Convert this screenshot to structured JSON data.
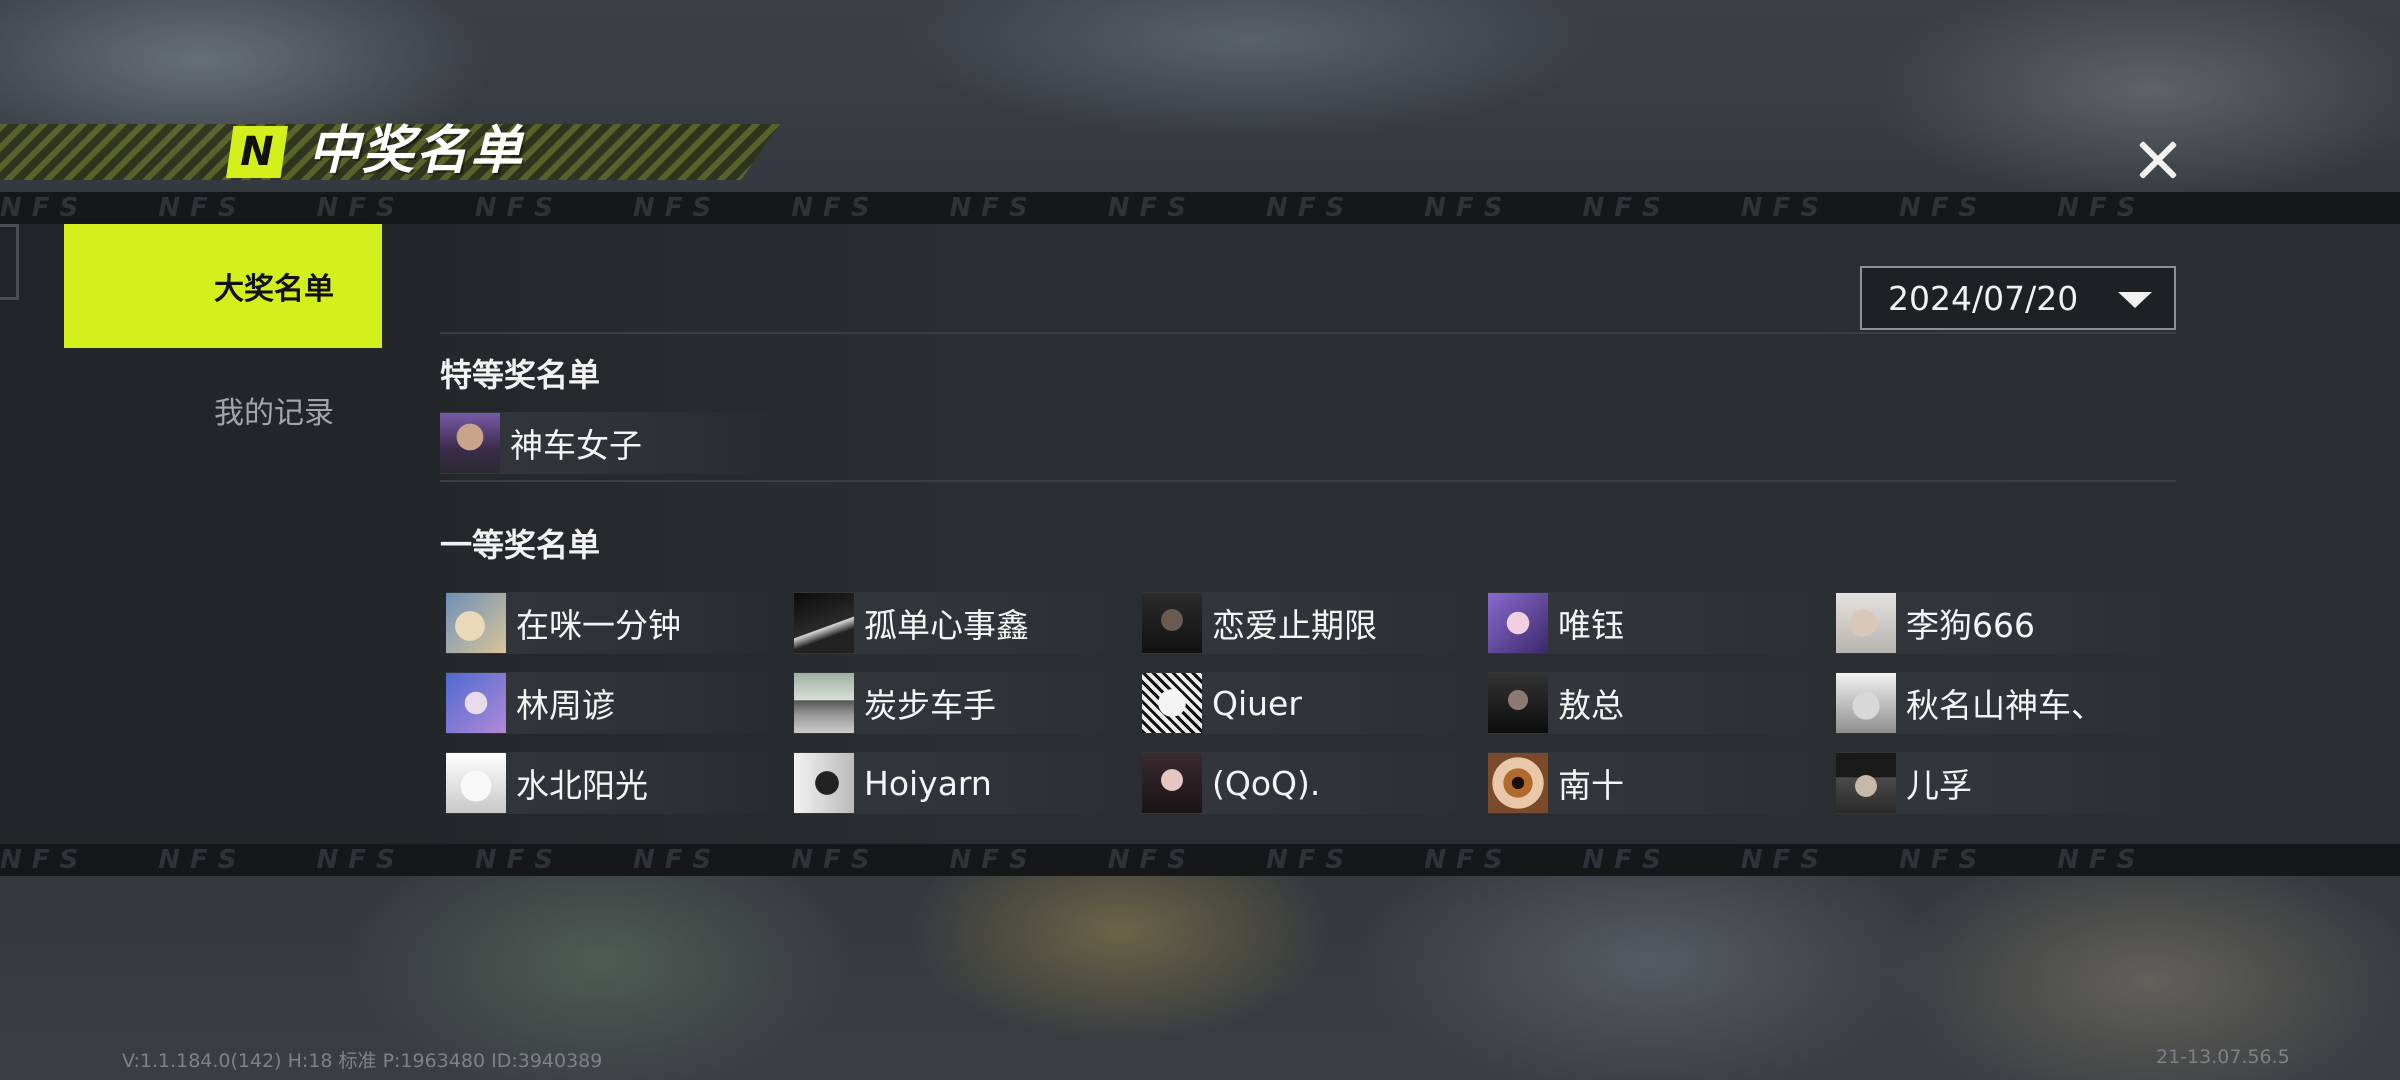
{
  "header": {
    "logo_letter": "N",
    "title": "中奖名单"
  },
  "nfs_watermark": [
    "NFS",
    "NFS",
    "NFS",
    "NFS",
    "NFS",
    "NFS",
    "NFS",
    "NFS",
    "NFS",
    "NFS",
    "NFS",
    "NFS",
    "NFS",
    "NFS"
  ],
  "sidebar": {
    "tabs": [
      {
        "label": "大奖名单",
        "active": true
      },
      {
        "label": "我的记录",
        "active": false
      }
    ]
  },
  "date_select": {
    "value": "2024/07/20"
  },
  "sections": {
    "grand": {
      "title": "特等奖名单",
      "winners": [
        {
          "name": "神车女子",
          "avatar": "avatar-purple-hair"
        }
      ]
    },
    "first": {
      "title": "一等奖名单",
      "winners": [
        {
          "name": "在咪一分钟",
          "avatar": "avatar-cartoon"
        },
        {
          "name": "孤单心事鑫",
          "avatar": "avatar-dark-hand"
        },
        {
          "name": "恋爱止期限",
          "avatar": "avatar-dark-person"
        },
        {
          "name": "唯钰",
          "avatar": "avatar-anime-purple"
        },
        {
          "name": "李狗666",
          "avatar": "avatar-light-person"
        },
        {
          "name": "林周谚",
          "avatar": "avatar-anime-blue"
        },
        {
          "name": "炭步车手",
          "avatar": "avatar-car"
        },
        {
          "name": "Qiuer",
          "avatar": "avatar-manga"
        },
        {
          "name": "敖总",
          "avatar": "avatar-dark-portrait"
        },
        {
          "name": "秋名山神车、",
          "avatar": "avatar-white-hood"
        },
        {
          "name": "水北阳光",
          "avatar": "avatar-white-hair"
        },
        {
          "name": "Hoiyarn",
          "avatar": "avatar-silhouette"
        },
        {
          "name": "(QoQ).",
          "avatar": "avatar-girl"
        },
        {
          "name": "南十",
          "avatar": "avatar-eye"
        },
        {
          "name": "儿孚",
          "avatar": "avatar-cap-person"
        }
      ]
    }
  },
  "footer": {
    "version": "V:1.1.184.0(142) H:18 标准 P:1963480 ID:3940389",
    "time": "21-13.07.56.5"
  },
  "colors": {
    "accent": "#d4f01c",
    "panel": "#2a2d31",
    "text": "#f2f2f2"
  }
}
